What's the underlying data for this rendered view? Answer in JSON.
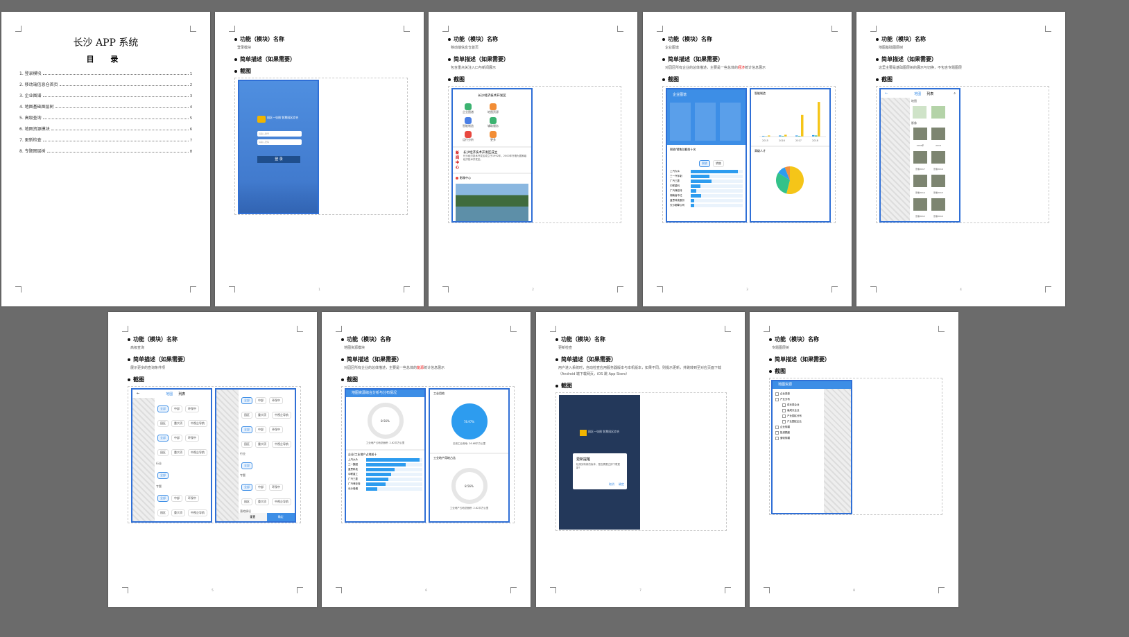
{
  "cover": {
    "title": "长沙 APP 系统",
    "toc_heading": "目  录",
    "toc": [
      {
        "label": "1. 登录模块",
        "page": "1"
      },
      {
        "label": "2. 移动端信息仓首页",
        "page": "2"
      },
      {
        "label": "3. 企业图谱",
        "page": "3"
      },
      {
        "label": "4. 地图基础图层树",
        "page": "4"
      },
      {
        "label": "5. 高级查询",
        "page": "5"
      },
      {
        "label": "6. 地图资源模块",
        "page": "6"
      },
      {
        "label": "7. 更新检查",
        "page": "7"
      },
      {
        "label": "8. 专题图层树",
        "page": "8"
      }
    ]
  },
  "labels": {
    "name": "功能（模块）名称",
    "desc": "简单描述（如果需要）",
    "screen": "截图"
  },
  "pages": [
    {
      "name": "登录模块",
      "desc": "",
      "num": "1"
    },
    {
      "name": "移动端信息仓首页",
      "desc": "包含重点关注入口与新闻展示",
      "num": "2"
    },
    {
      "name": "企业图谱",
      "desc_pre": "对园区所有企业的总体描述，主要是一些总体的",
      "desc_red": "经济",
      "desc_post": "统计信息展示",
      "num": "3"
    },
    {
      "name": "地图基础图层树",
      "desc": "这里主要是基础图层树的展示与切换，不包含专题图层",
      "num": "4"
    },
    {
      "name": "高级查询",
      "desc": "展示更多的查询条件项",
      "num": "5"
    },
    {
      "name": "地图资源模块",
      "desc_pre": "对园区所有企业的总体描述，主要是一些总体的",
      "desc_red": "能源",
      "desc_post": "统计信息展示",
      "num": "6"
    },
    {
      "name": "更新检查",
      "desc": "用户进入系统时，自动检查应用服务器版本与本机版本，如果不同，则提示更新，并跳转到至对应页面下载（Android 端下载网页，iOS 跳 App Store）",
      "num": "7"
    },
    {
      "name": "专题图层树",
      "desc": "",
      "num": "8"
    }
  ],
  "screens": {
    "login": {
      "banner": "园区一张图 智慧园区综合",
      "user_ph": "请输入账号",
      "pwd_ph": "请输入密码",
      "button": "登 录"
    },
    "home": {
      "title": "长沙经济技术开发区",
      "icons": [
        "企业图谱",
        "地图资源",
        "智能制造",
        "辅助服务",
        "运行分析",
        "更多"
      ],
      "news_title": "长沙经济技术开发区成立",
      "news_body": "长沙经济技术开发区成立于1992年，2000年升格为国家级经济技术开发区。",
      "news_tag": "新闻中心",
      "video_tag": "影像中心"
    },
    "enterprise": {
      "header": "企业图谱",
      "panel2": "智能制造",
      "panel3": "高级人才",
      "rank_title": "税收/销售总额前十名",
      "tabs": [
        "税收",
        "销售"
      ],
      "companies": [
        {
          "name": "上汽大众",
          "val": 90
        },
        {
          "name": "三一汽车制",
          "val": 36
        },
        {
          "name": "广汽三菱",
          "val": 40
        },
        {
          "name": "中联重科",
          "val": 18
        },
        {
          "name": "广汽菲亚特",
          "val": 11
        },
        {
          "name": "湖南省中达",
          "val": 20
        },
        {
          "name": "蓝思科技股份",
          "val": 7
        },
        {
          "name": "长沙烟草公司",
          "val": 6
        }
      ],
      "bar_years": [
        "2015",
        "2016",
        "2017",
        "2018"
      ],
      "bar_series": [
        {
          "name": "研究生",
          "color": "#2d9cef",
          "values": [
            2,
            3,
            3,
            4
          ]
        },
        {
          "name": "本科",
          "color": "#33c28a",
          "values": [
            1,
            2,
            2,
            3
          ]
        },
        {
          "name": "专科",
          "color": "#f5c518",
          "values": [
            3,
            5,
            60,
            96
          ]
        }
      ],
      "pie": [
        {
          "label": "A",
          "value": 54,
          "color": "#f5c518"
        },
        {
          "label": "B",
          "value": 30,
          "color": "#33c28a"
        },
        {
          "label": "C",
          "value": 10,
          "color": "#2d9cef"
        },
        {
          "label": "D",
          "value": 6,
          "color": "#f2913d"
        }
      ]
    },
    "layers": {
      "tabs": [
        "地图",
        "列表"
      ],
      "sec1": "地图",
      "sec2": "影像",
      "tiles": [
        "2016年",
        "2018",
        "影像2017",
        "影像2019",
        "影像2014",
        "影像2015",
        "影像2012",
        "影像2010",
        "影像2013"
      ]
    },
    "query": {
      "tabs": [
        "地图",
        "列表"
      ],
      "filters": [
        "全部",
        "中部",
        "环保中",
        "园区",
        "重大项",
        "中视企导航"
      ],
      "sections": [
        "行业",
        "专题",
        "落地情况"
      ],
      "cancel": "重置",
      "confirm": "确定"
    },
    "resource": {
      "header": "地图资源综合分析与分布情况",
      "panel2": "工业用地",
      "ring1_pct": "8.56%",
      "ring1_caption": "工业地产占地总面积: 2.62平方公里",
      "ring2_pct": "78.97%",
      "ring2_caption": "已用工业用地: 26.68平方公里",
      "rank_title": "企业/工业地产占地前十",
      "panel4": "工业地产用地占比",
      "ring3_pct": "8.56%",
      "ring3_caption": "工业地产占地总面积: 2.62平方公里",
      "companies": [
        {
          "name": "上汽大众",
          "val": 95
        },
        {
          "name": "三一集团",
          "val": 70
        },
        {
          "name": "蓝思科技",
          "val": 50
        },
        {
          "name": "中联重工",
          "val": 45
        },
        {
          "name": "广汽三菱",
          "val": 40
        },
        {
          "name": "广汽菲亚特",
          "val": 35
        },
        {
          "name": "长沙卷烟",
          "val": 20
        }
      ]
    },
    "update": {
      "dlg_title": "更新提醒",
      "dlg_body": "检测到有新的版本，是否需要立即下载更新?",
      "cancel": "取消",
      "ok": "确定",
      "banner": "园区一张图 智慧园区综合"
    },
    "thematic": {
      "header": "地图资源",
      "items": [
        "企业类型",
        "产业分布",
        "成长类企业",
        "高成长企业",
        "产业园区分布",
        "产业园区企业",
        "企业规模",
        "投资额度",
        "营收规模"
      ]
    }
  }
}
